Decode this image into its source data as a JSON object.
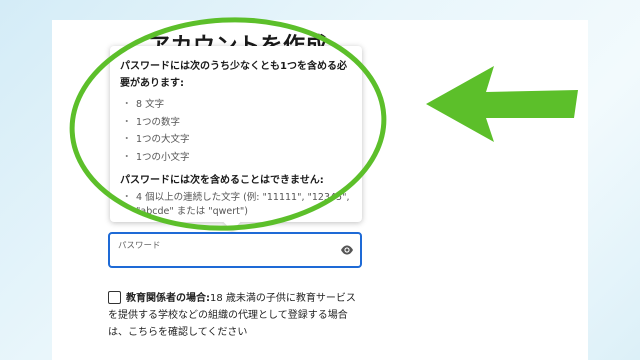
{
  "page": {
    "title": "アカウントを作成"
  },
  "tooltip": {
    "heading_required": "パスワードには次のうち少なくとも1つを含める必要があります:",
    "requirements": [
      "8 文字",
      "1つの数字",
      "1つの大文字",
      "1つの小文字"
    ],
    "heading_forbidden": "パスワードには次を含めることはできません:",
    "forbidden_line1": "4 個以上の連続した文字 (例: \"11111\", \"12345\",",
    "forbidden_line2": "\"abcde\" または \"qwert\")"
  },
  "password_field": {
    "label": "パスワード",
    "value": "",
    "icon": "eye-icon"
  },
  "educator": {
    "bold": "教育関係者の場合:",
    "line1": "18 歳未満の子供に教育サービス",
    "line2": "を提供する学校などの組織の代理として登録する場合",
    "line3": "は、こちらを確認してください"
  },
  "colors": {
    "accent_blue": "#1e6ad6",
    "annotation_green": "#5cbf2a",
    "background": "#e3f3fa"
  }
}
